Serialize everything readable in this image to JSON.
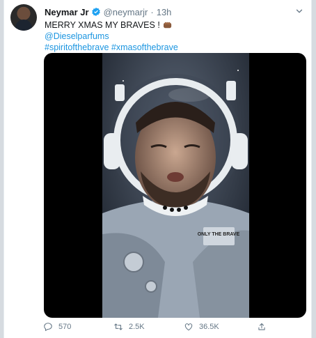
{
  "tweet": {
    "author_name": "Neymar Jr",
    "handle": "@neymarjr",
    "separator": "·",
    "time": "13h",
    "text_line1": "MERRY XMAS MY BRAVES !",
    "mention": "@Dieselparfums",
    "hashtags": "#spiritofthebrave #xmasofthebrave",
    "patch_text": "ONLY THE BRAVE"
  },
  "actions": {
    "replies": "570",
    "retweets": "2.5K",
    "likes": "36.5K"
  },
  "colors": {
    "link": "#1b95e0",
    "verified": "#1da1f2",
    "muted": "#657786"
  },
  "icons": [
    "verified-badge-icon",
    "chevron-down-icon",
    "fist-emoji-icon",
    "reply-icon",
    "retweet-icon",
    "like-icon",
    "share-icon"
  ]
}
